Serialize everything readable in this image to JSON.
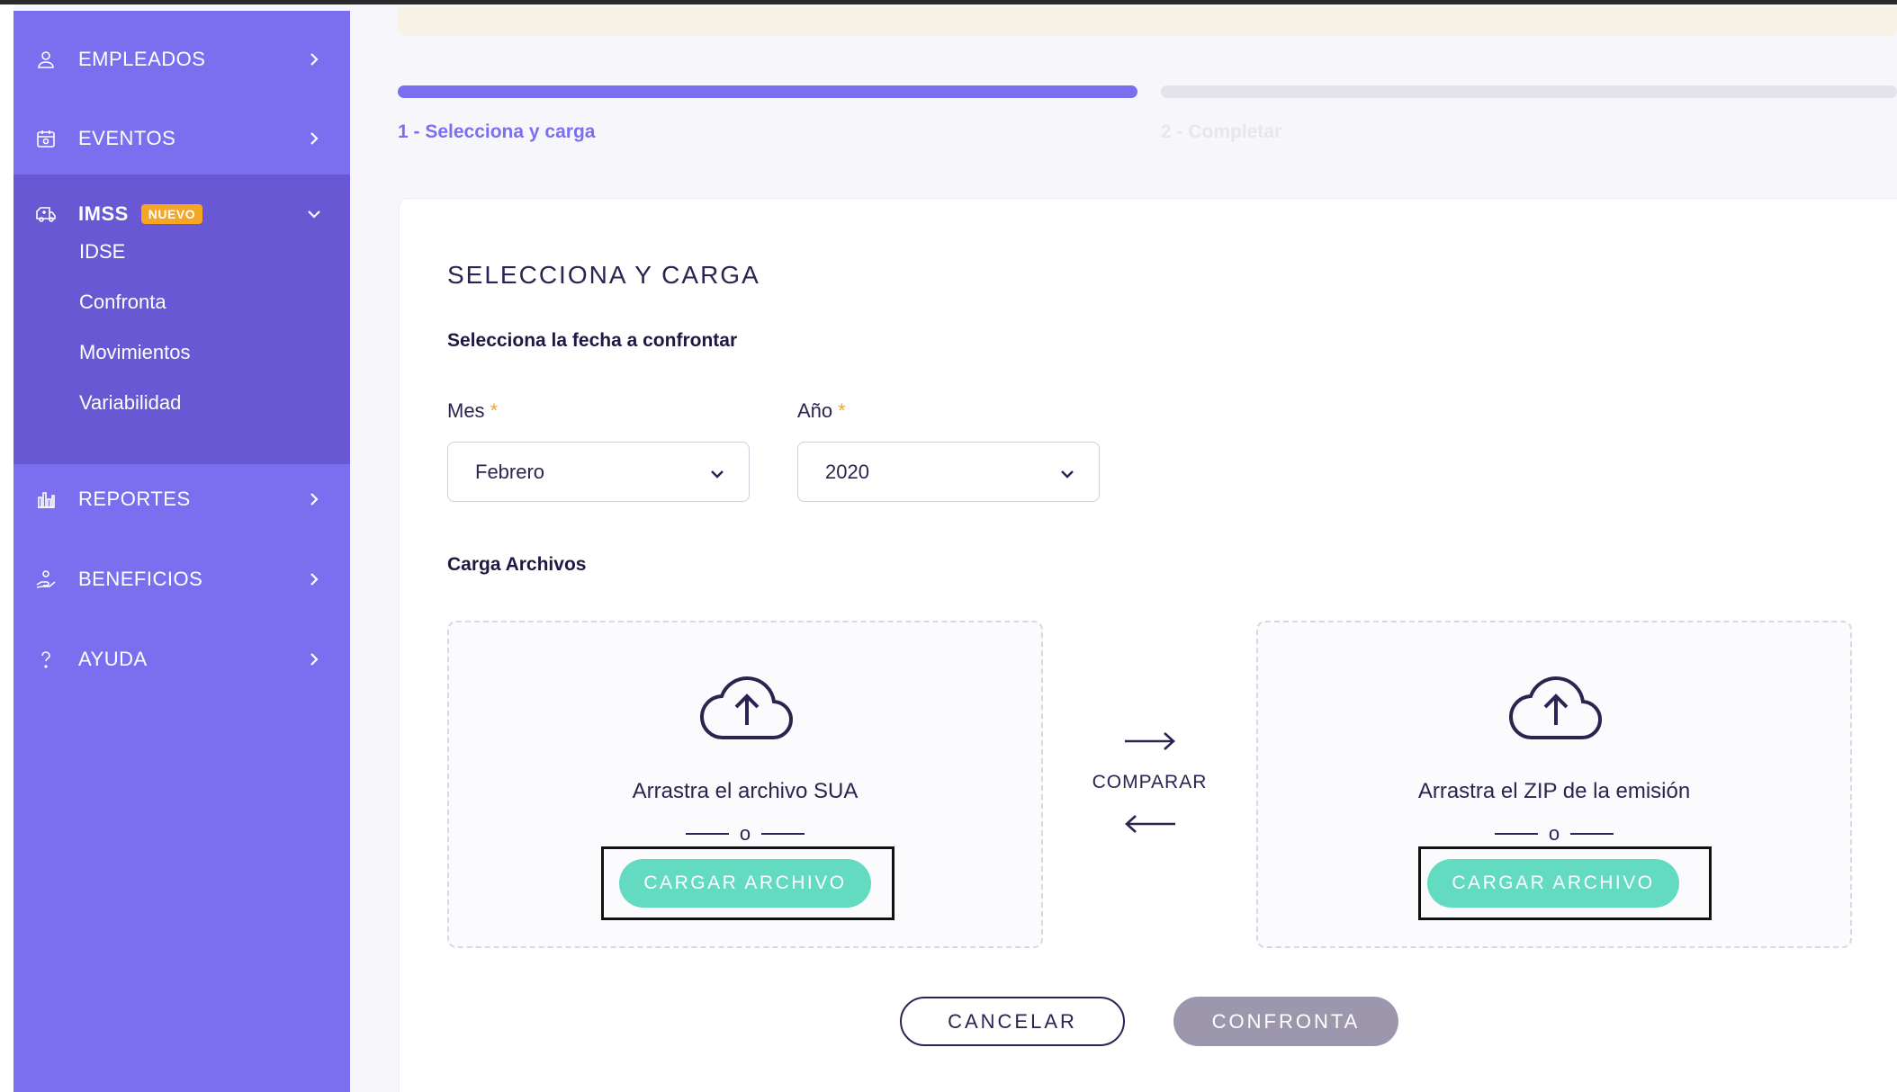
{
  "sidebar": {
    "items": [
      {
        "label": "EMPLEADOS",
        "icon": "user-icon"
      },
      {
        "label": "EVENTOS",
        "icon": "calendar-icon"
      },
      {
        "label": "IMSS",
        "icon": "ambulance-icon",
        "badge": "NUEVO",
        "expanded": true,
        "subitems": [
          "IDSE",
          "Confronta",
          "Movimientos",
          "Variabilidad"
        ]
      },
      {
        "label": "REPORTES",
        "icon": "bar-chart-icon"
      },
      {
        "label": "BENEFICIOS",
        "icon": "hand-gift-icon"
      },
      {
        "label": "AYUDA",
        "icon": "question-icon"
      }
    ]
  },
  "steps": [
    {
      "label": "1 - Selecciona y carga",
      "active": true
    },
    {
      "label": "2 - Completar",
      "active": false
    }
  ],
  "form": {
    "title": "SELECCIONA Y CARGA",
    "date_subtitle": "Selecciona la fecha a confrontar",
    "month": {
      "label": "Mes",
      "required_mark": "*",
      "value": "Febrero"
    },
    "year": {
      "label": "Año",
      "required_mark": "*",
      "value": "2020"
    },
    "files_subtitle": "Carga Archivos"
  },
  "upload": {
    "left": {
      "text": "Arrastra el archivo SUA",
      "or": "o",
      "button": "CARGAR ARCHIVO"
    },
    "right": {
      "text": "Arrastra el ZIP de la emisión",
      "or": "o",
      "button": "CARGAR ARCHIVO"
    },
    "compare_label": "COMPARAR"
  },
  "actions": {
    "cancel": "CANCELAR",
    "confronta": "CONFRONTA"
  },
  "colors": {
    "sidebar": "#7b6ff0",
    "sidebar_active": "#6858d4",
    "accent": "#7b6ff0",
    "badge": "#f6a623",
    "upload_button": "#62dbc0",
    "disabled_button": "#9d97ad",
    "text_dark": "#2b2350"
  }
}
